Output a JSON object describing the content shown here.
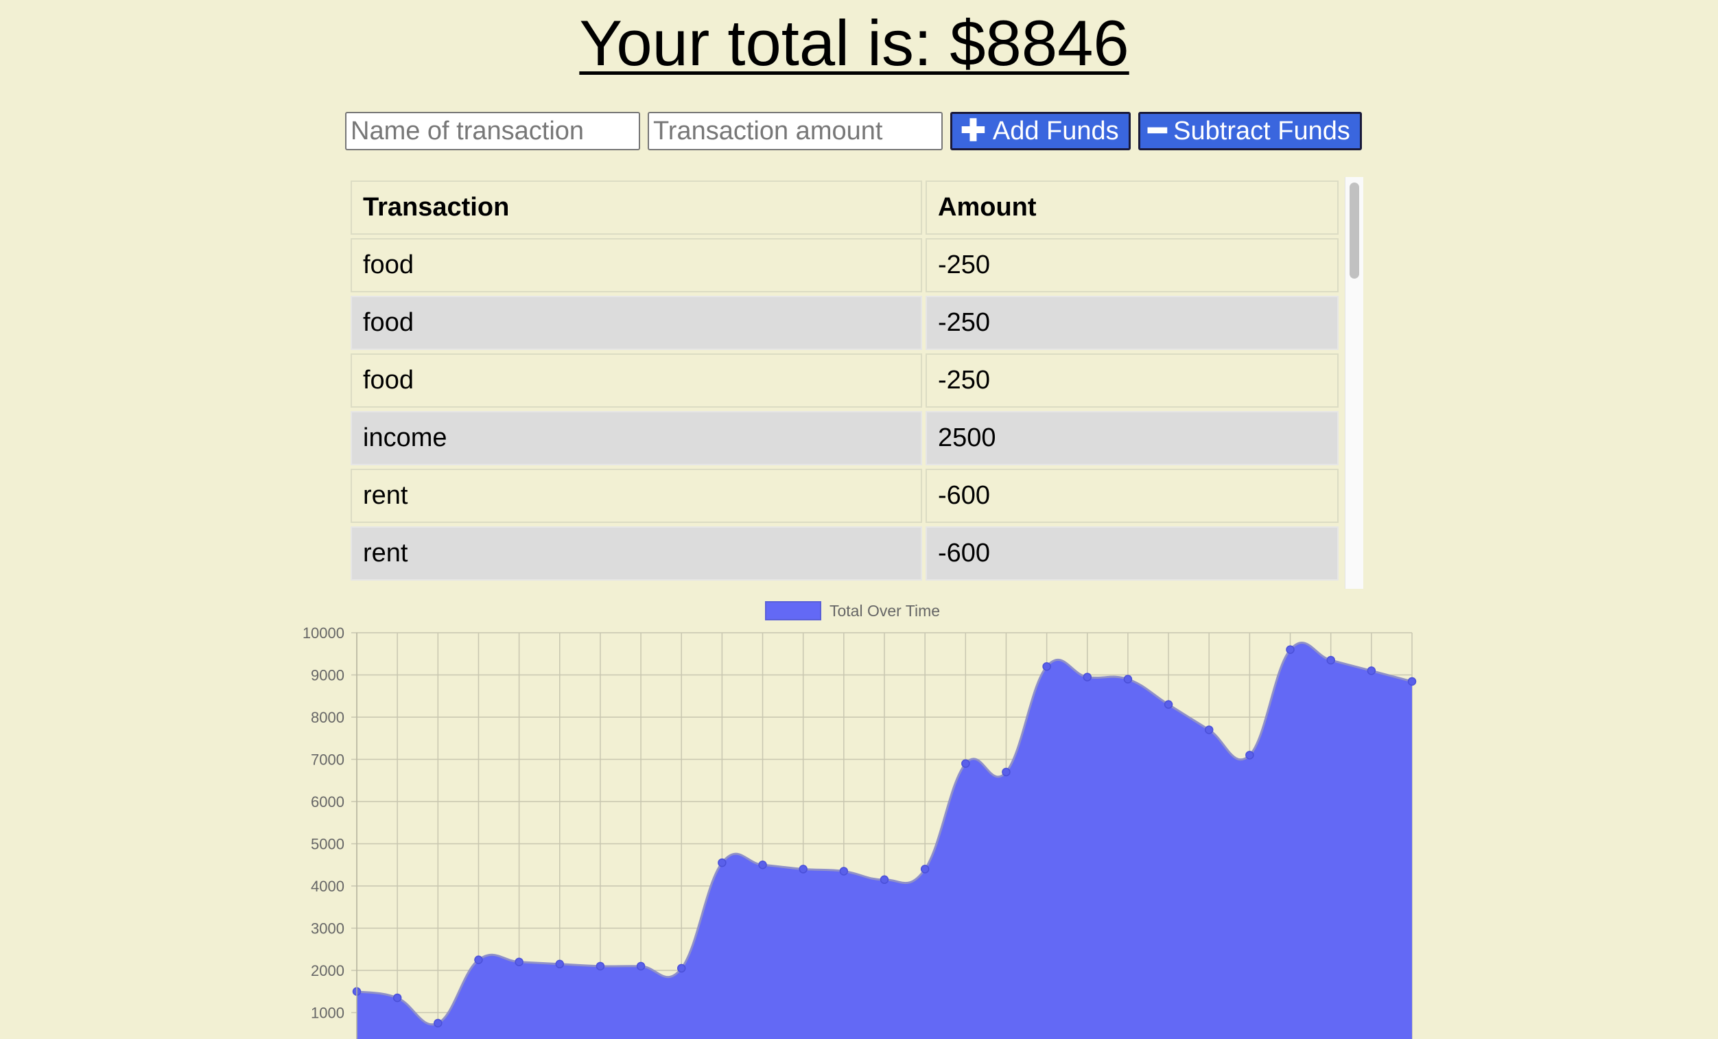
{
  "header": {
    "title": "Your total is: $8846"
  },
  "form": {
    "name_placeholder": "Name of transaction",
    "amount_placeholder": "Transaction amount",
    "add_label": "Add Funds",
    "subtract_label": "Subtract Funds",
    "add_icon": "plus-icon",
    "subtract_icon": "minus-icon"
  },
  "table": {
    "headers": [
      "Transaction",
      "Amount"
    ],
    "rows": [
      {
        "name": "food",
        "amount": "-250"
      },
      {
        "name": "food",
        "amount": "-250"
      },
      {
        "name": "food",
        "amount": "-250"
      },
      {
        "name": "income",
        "amount": "2500"
      },
      {
        "name": "rent",
        "amount": "-600"
      },
      {
        "name": "rent",
        "amount": "-600"
      }
    ]
  },
  "colors": {
    "background": "#f2f0d3",
    "accent": "#3a66de",
    "chart_fill": "#6369f5",
    "row_alt": "#dcdcdc"
  },
  "chart_data": {
    "type": "area",
    "legend": "Total Over Time",
    "legend_position": "top",
    "grid": true,
    "ylim": [
      0,
      10000
    ],
    "yticks": [
      1000,
      2000,
      3000,
      4000,
      5000,
      6000,
      7000,
      8000,
      9000,
      10000
    ],
    "series": [
      {
        "name": "Total Over Time",
        "values": [
          1500,
          1350,
          750,
          2250,
          2200,
          2150,
          2100,
          2100,
          2050,
          4550,
          4500,
          4400,
          4350,
          4150,
          4400,
          6900,
          6700,
          9200,
          8950,
          8900,
          8300,
          7700,
          7100,
          9600,
          9350,
          9100,
          8846
        ]
      }
    ]
  }
}
